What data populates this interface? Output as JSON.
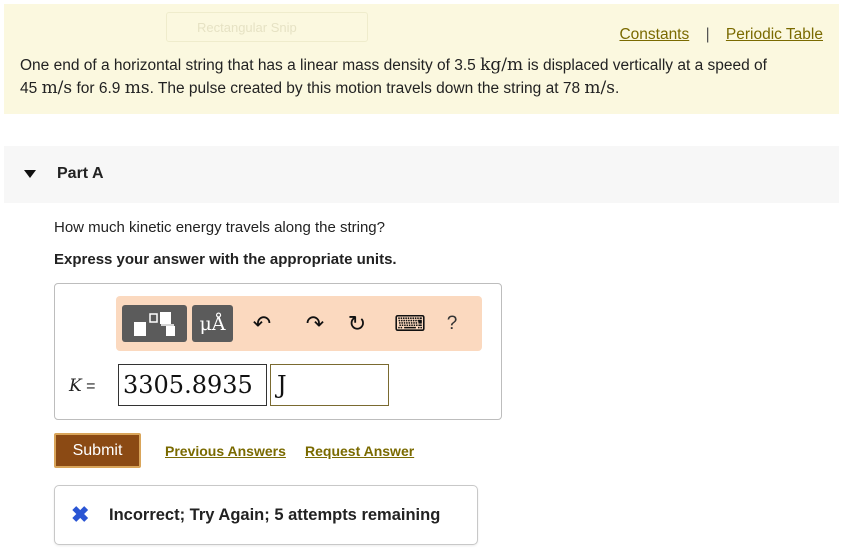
{
  "header": {
    "ghost_label": "Rectangular Snip",
    "links": {
      "constants": "Constants",
      "separator": "|",
      "periodic_table": "Periodic Table"
    }
  },
  "statement": {
    "t1": "One end of a horizontal string that has a linear mass density of 3.5 ",
    "u1": "kg/m",
    "t2": " is displaced vertically at a speed of",
    "t3": "45 ",
    "u2": "m/s",
    "t4": " for 6.9 ",
    "u3": "ms",
    "t5": ". The pulse created by this motion travels down the string at 78 ",
    "u4": "m/s",
    "t6": "."
  },
  "part": {
    "title": "Part A"
  },
  "question": "How much kinetic energy travels along the string?",
  "instruction": "Express your answer with the appropriate units.",
  "toolbar": {
    "units_button": "μÅ",
    "undo": "↶",
    "redo": "↷",
    "reset": "↻",
    "keyboard": "⌨",
    "help": "?"
  },
  "answer": {
    "variable": "K",
    "equals": "=",
    "value": "3305.8935",
    "unit": "J"
  },
  "actions": {
    "submit": "Submit",
    "previous_answers": "Previous Answers",
    "request_answer": "Request Answer"
  },
  "feedback": {
    "message": "Incorrect; Try Again; 5 attempts remaining",
    "icon": "✖"
  },
  "colors": {
    "link": "#7a6a00",
    "statement_bg": "#fbf8df",
    "toolbar_bg": "#fbd9bf",
    "submit_bg": "#8b4a14",
    "error_icon": "#2a55d4"
  }
}
